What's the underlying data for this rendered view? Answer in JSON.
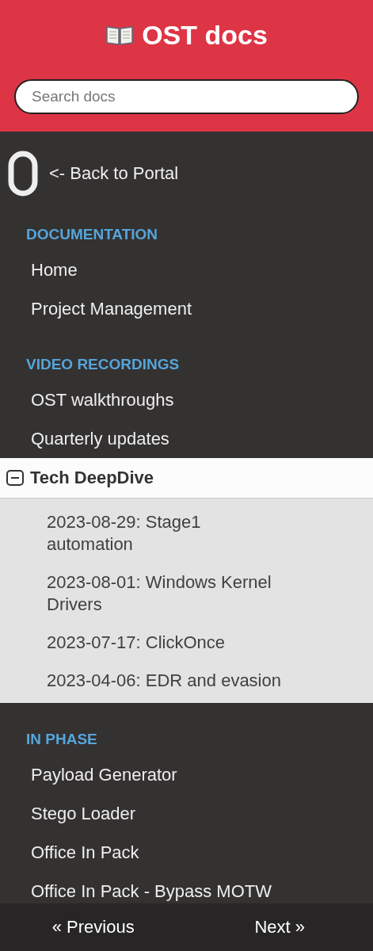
{
  "header": {
    "title": "OST docs",
    "search": {
      "placeholder": "Search docs"
    }
  },
  "back_link": "<- Back to Portal",
  "sections": [
    {
      "caption": "DOCUMENTATION",
      "items": [
        {
          "label": "Home"
        },
        {
          "label": "Project Management"
        }
      ]
    },
    {
      "caption": "VIDEO RECORDINGS",
      "items": [
        {
          "label": "OST walkthroughs"
        },
        {
          "label": "Quarterly updates"
        },
        {
          "label": "Tech DeepDive",
          "expanded": true,
          "children": [
            {
              "label": "2023-08-29: Stage1 automation"
            },
            {
              "label": "2023-08-01: Windows Kernel Drivers"
            },
            {
              "label": "2023-07-17: ClickOnce"
            },
            {
              "label": "2023-04-06: EDR and evasion"
            }
          ]
        }
      ]
    },
    {
      "caption": "IN PHASE",
      "items": [
        {
          "label": "Payload Generator"
        },
        {
          "label": "Stego Loader"
        },
        {
          "label": "Office In Pack"
        },
        {
          "label": "Office In Pack - Bypass MOTW"
        }
      ]
    }
  ],
  "footer": {
    "previous": "« Previous",
    "next": "Next »"
  }
}
